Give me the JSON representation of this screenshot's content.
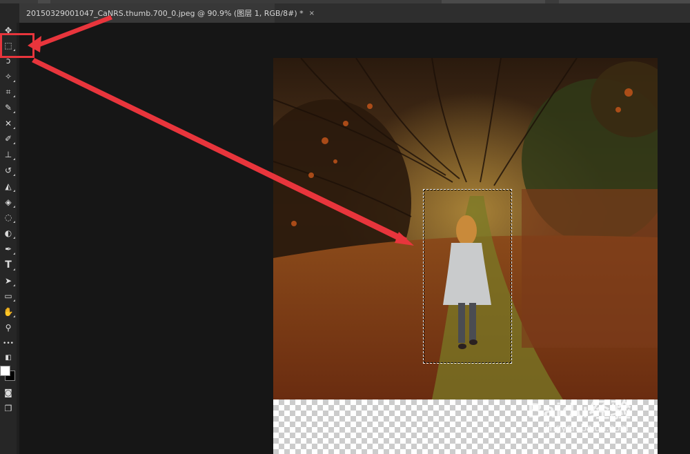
{
  "document": {
    "tab_title": "20150329001047_CaNRS.thumb.700_0.jpeg @ 90.9% (图层 1, RGB/8#) *",
    "close_glyph": "×"
  },
  "tools": [
    {
      "name": "move-tool-icon",
      "glyph": "✥"
    },
    {
      "name": "rectangular-marquee-tool-icon",
      "glyph": "⬚"
    },
    {
      "name": "lasso-tool-icon",
      "glyph": "ↄ"
    },
    {
      "name": "magic-wand-tool-icon",
      "glyph": "✧"
    },
    {
      "name": "crop-tool-icon",
      "glyph": "⌗"
    },
    {
      "name": "eyedropper-tool-icon",
      "glyph": "✎"
    },
    {
      "name": "healing-brush-tool-icon",
      "glyph": "✕"
    },
    {
      "name": "brush-tool-icon",
      "glyph": "✐"
    },
    {
      "name": "clone-stamp-tool-icon",
      "glyph": "⊥"
    },
    {
      "name": "history-brush-tool-icon",
      "glyph": "↺"
    },
    {
      "name": "eraser-tool-icon",
      "glyph": "◭"
    },
    {
      "name": "paint-bucket-tool-icon",
      "glyph": "◈"
    },
    {
      "name": "blur-tool-icon",
      "glyph": "◌"
    },
    {
      "name": "dodge-tool-icon",
      "glyph": "◐"
    },
    {
      "name": "pen-tool-icon",
      "glyph": "✒"
    },
    {
      "name": "type-tool-icon",
      "glyph": "T"
    },
    {
      "name": "path-selection-tool-icon",
      "glyph": "➤"
    },
    {
      "name": "rectangle-shape-tool-icon",
      "glyph": "▭"
    },
    {
      "name": "hand-tool-icon",
      "glyph": "✋"
    },
    {
      "name": "zoom-tool-icon",
      "glyph": "⚲"
    },
    {
      "name": "more-tools-icon",
      "glyph": "•••"
    },
    {
      "name": "default-colors-icon",
      "glyph": "◧"
    },
    {
      "name": "quick-mask-icon",
      "glyph": "◙"
    },
    {
      "name": "screen-mode-icon",
      "glyph": "❐"
    }
  ],
  "colors": {
    "foreground": "#ffffff",
    "background": "#000000",
    "highlight_red": "#e8353c"
  },
  "watermark": {
    "brand": "Baidu经验",
    "url": "jingyan.baidu.com"
  }
}
